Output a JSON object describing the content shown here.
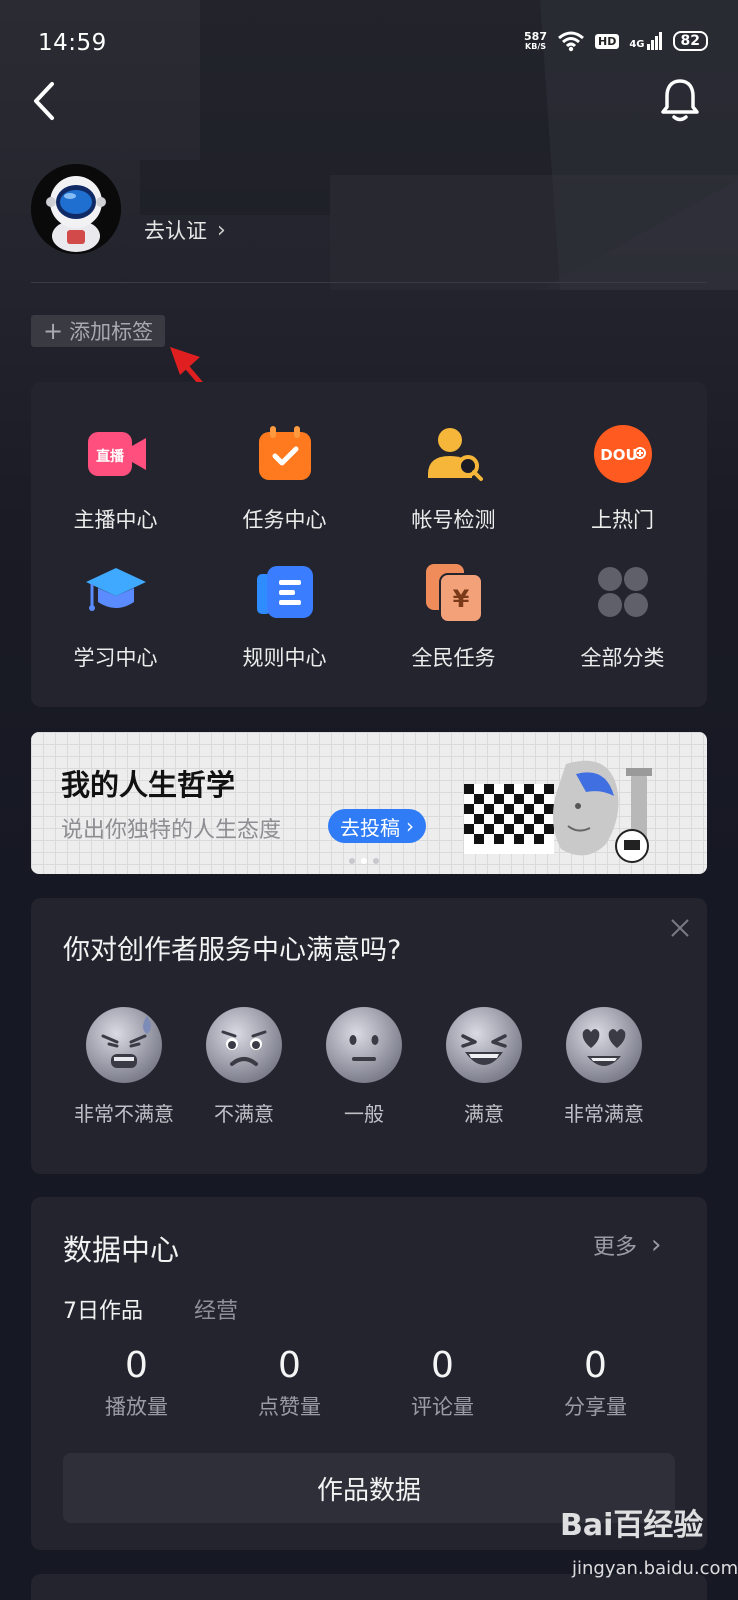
{
  "status_bar": {
    "time": "14:59",
    "net_speed": "587",
    "net_unit": "KB/S",
    "hd": "HD",
    "network": "4G",
    "battery": "82"
  },
  "header": {
    "back_icon": "chevron-left-icon",
    "notification_icon": "bell-icon"
  },
  "profile": {
    "verify_label": "去认证",
    "add_tag_label": "添加标签"
  },
  "tools": [
    {
      "label": "主播中心",
      "icon": "live-camera-icon"
    },
    {
      "label": "任务中心",
      "icon": "task-calendar-icon"
    },
    {
      "label": "帐号检测",
      "icon": "account-check-icon"
    },
    {
      "label": "上热门",
      "icon": "dou-plus-icon"
    },
    {
      "label": "学习中心",
      "icon": "graduation-cap-icon"
    },
    {
      "label": "规则中心",
      "icon": "rules-book-icon"
    },
    {
      "label": "全民任务",
      "icon": "money-task-icon"
    },
    {
      "label": "全部分类",
      "icon": "grid-dots-icon"
    }
  ],
  "tool_icon_texts": {
    "live": "直播",
    "dou": "DOU"
  },
  "banner": {
    "title": "我的人生哲学",
    "subtitle": "说出你独特的人生态度",
    "button": "去投稿",
    "active_dot": 1,
    "dot_count": 3
  },
  "survey": {
    "title": "你对创作者服务中心满意吗?",
    "options": [
      "非常不满意",
      "不满意",
      "一般",
      "满意",
      "非常满意"
    ]
  },
  "data_center": {
    "title": "数据中心",
    "more": "更多",
    "tabs": [
      "7日作品",
      "经营"
    ],
    "stats": [
      {
        "value": "0",
        "label": "播放量"
      },
      {
        "value": "0",
        "label": "点赞量"
      },
      {
        "value": "0",
        "label": "评论量"
      },
      {
        "value": "0",
        "label": "分享量"
      }
    ],
    "works_button": "作品数据"
  },
  "watermark": {
    "brand": "Bai百经验",
    "url": "jingyan.baidu.com"
  },
  "colors": {
    "accent_blue": "#2f7cf6",
    "card": "#23242e",
    "arrow_red": "#e02020"
  }
}
